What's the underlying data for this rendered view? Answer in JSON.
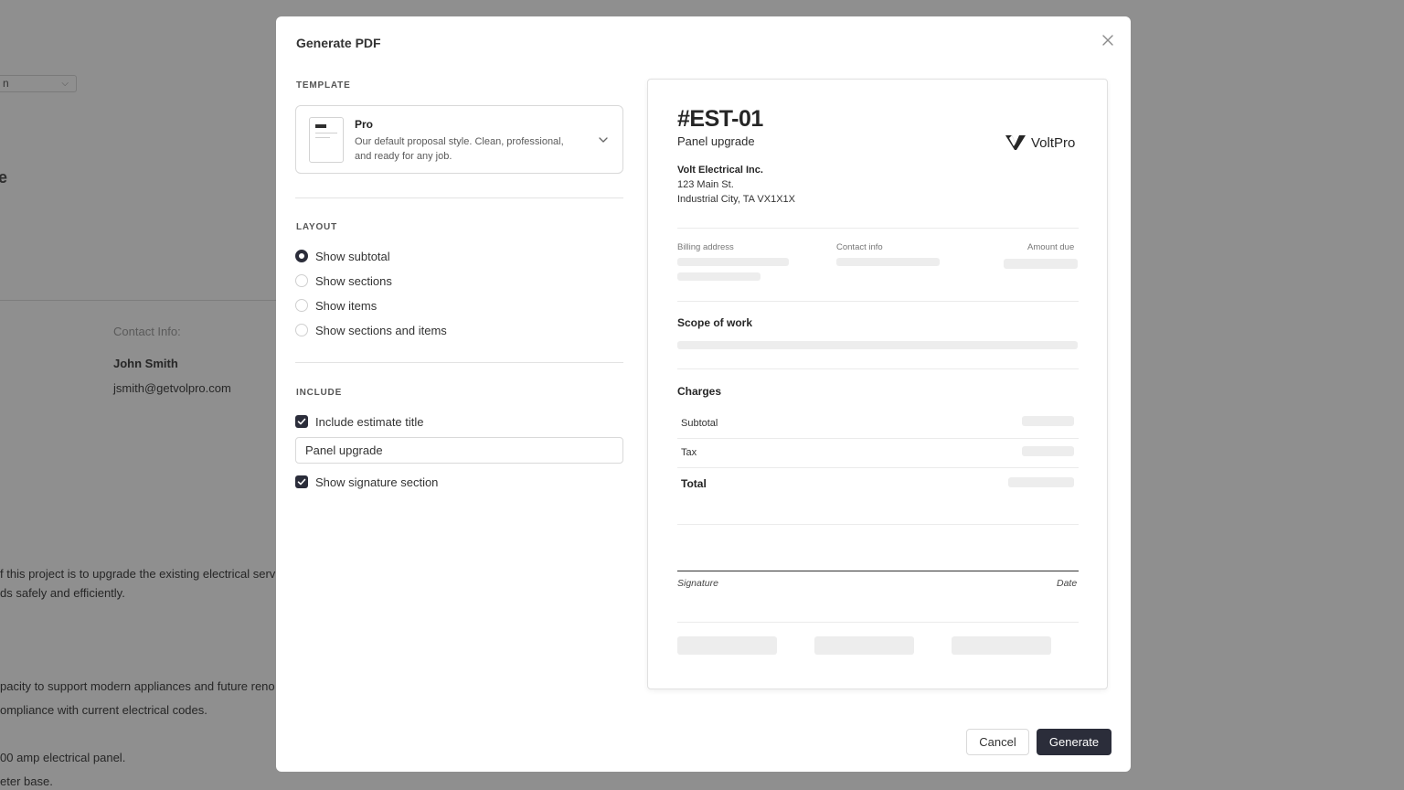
{
  "background": {
    "select_value": "n",
    "heading_fragment": "e",
    "contact_label": "Contact Info:",
    "contact_name": "John Smith",
    "contact_email": "jsmith@getvolpro.com",
    "paragraph_lines": [
      "f this project is to upgrade the existing electrical serv",
      "ds safely and efficiently.",
      "pacity to support modern appliances and future reno",
      "ompliance with current electrical codes.",
      "00 amp electrical panel.",
      "eter base."
    ]
  },
  "modal": {
    "title": "Generate PDF",
    "template": {
      "section_label": "TEMPLATE",
      "name": "Pro",
      "description": "Our default proposal style. Clean, professional, and ready for any job."
    },
    "layout": {
      "section_label": "LAYOUT",
      "selected": "Show subtotal",
      "options": [
        "Show subtotal",
        "Show sections",
        "Show items",
        "Show sections and items"
      ]
    },
    "include": {
      "section_label": "INCLUDE",
      "estimate_title_label": "Include estimate title",
      "estimate_title_checked": true,
      "estimate_title_value": "Panel upgrade",
      "signature_label": "Show signature section",
      "signature_checked": true
    },
    "preview": {
      "number": "#EST-01",
      "title": "Panel upgrade",
      "brand": "VoltPro",
      "company": "Volt Electrical Inc.",
      "address_line1": "123 Main St.",
      "address_line2": "Industrial City, TA VX1X1X",
      "billing_label": "Billing address",
      "contact_label": "Contact info",
      "amount_due_label": "Amount due",
      "scope_heading": "Scope of work",
      "charges_heading": "Charges",
      "subtotal_label": "Subtotal",
      "tax_label": "Tax",
      "total_label": "Total",
      "signature_label": "Signature",
      "date_label": "Date"
    },
    "buttons": {
      "cancel": "Cancel",
      "generate": "Generate"
    }
  },
  "colors": {
    "overlay": "#8f8f8f",
    "primary_button": "#2b2d3a",
    "placeholder_bar": "#ededed"
  }
}
